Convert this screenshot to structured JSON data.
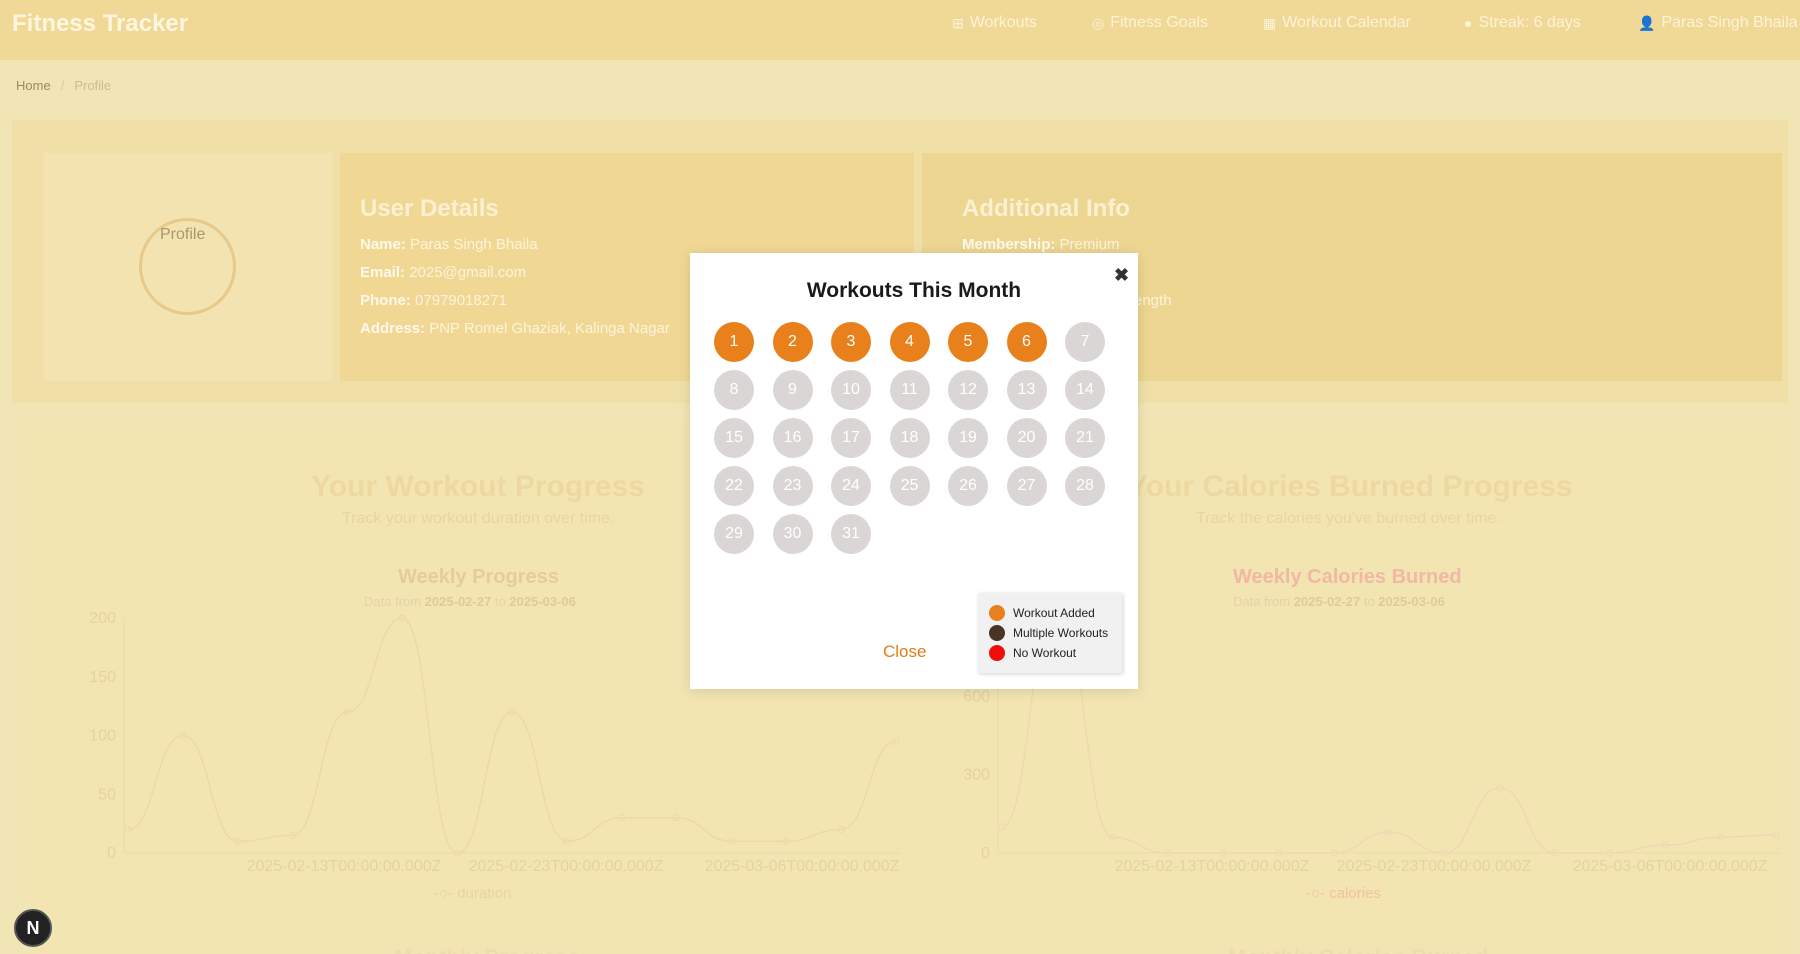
{
  "app": {
    "brand": "Fitness Tracker"
  },
  "nav": {
    "items": [
      {
        "icon": "dumbbell-icon",
        "label": "Workouts"
      },
      {
        "icon": "target-icon",
        "label": "Fitness Goals"
      },
      {
        "icon": "calendar-icon",
        "label": "Workout Calendar"
      },
      {
        "icon": "streak-icon",
        "label": "Streak: 6 days"
      },
      {
        "icon": "user-icon",
        "label": "Paras Singh Bhaila"
      }
    ]
  },
  "breadcrumb": {
    "home": "Home",
    "separator": "/",
    "current": "Profile"
  },
  "profile": {
    "avatar_alt": "Profile"
  },
  "user_details": {
    "title": "User Details",
    "name_label": "Name:",
    "name": "Paras Singh Bhaila",
    "email_label": "Email:",
    "email": "2025@gmail.com",
    "phone_label": "Phone:",
    "phone": "07979018271",
    "address_label": "Address:",
    "address": "PNP Romel Ghaziak, Kalinga Nagar"
  },
  "additional_info": {
    "title": "Additional Info",
    "membership_label": "Membership:",
    "membership": "Premium",
    "partial_text": "ength"
  },
  "workout_progress": {
    "title": "Your Workout Progress",
    "subtitle": "Track your workout duration over time.",
    "chart_title": "Weekly Progress",
    "date_prefix": "Data from",
    "date_from": "2025-02-27",
    "date_to_word": "to",
    "date_to": "2025-03-06",
    "legend": "duration"
  },
  "calories_progress": {
    "title": "Your Calories Burned Progress",
    "subtitle": "Track the calories you've burned over time.",
    "chart_title": "Weekly Calories Burned",
    "date_prefix": "Data from",
    "date_from": "2025-02-27",
    "date_to_word": "to",
    "date_to": "2025-03-06",
    "legend": "calories"
  },
  "bottom": {
    "left_title": "Monthly Progress",
    "right_title": "Monthly Calories Burned"
  },
  "chart_data": [
    {
      "type": "line",
      "title": "Weekly Progress",
      "x_ticks": [
        "2025-02-13T00:00:00.000Z",
        "2025-02-23T00:00:00.000Z",
        "2025-03-06T00:00:00.000Z"
      ],
      "y_ticks": [
        "0",
        "50",
        "100",
        "150",
        "200"
      ],
      "ylim": [
        0,
        200
      ],
      "series": [
        {
          "name": "duration",
          "values": [
            20,
            100,
            10,
            15,
            120,
            200,
            0,
            120,
            10,
            30,
            30,
            10,
            10,
            20,
            95
          ]
        }
      ]
    },
    {
      "type": "line",
      "title": "Weekly Calories Burned",
      "x_ticks": [
        "2025-02-13T00:00:00.000Z",
        "2025-02-23T00:00:00.000Z",
        "2025-03-06T00:00:00.000Z"
      ],
      "y_ticks": [
        "0",
        "300",
        "600"
      ],
      "ylim": [
        0,
        900
      ],
      "series": [
        {
          "name": "calories",
          "values": [
            100,
            950,
            60,
            0,
            0,
            0,
            0,
            80,
            0,
            250,
            0,
            0,
            30,
            60,
            70
          ]
        }
      ]
    }
  ],
  "modal": {
    "title": "Workouts This Month",
    "close_x": "✖",
    "close_label": "Close",
    "days": [
      {
        "n": "1",
        "s": "added"
      },
      {
        "n": "2",
        "s": "added"
      },
      {
        "n": "3",
        "s": "added"
      },
      {
        "n": "4",
        "s": "added"
      },
      {
        "n": "5",
        "s": "added"
      },
      {
        "n": "6",
        "s": "added"
      },
      {
        "n": "7",
        "s": "none"
      },
      {
        "n": "8",
        "s": "none"
      },
      {
        "n": "9",
        "s": "none"
      },
      {
        "n": "10",
        "s": "none"
      },
      {
        "n": "11",
        "s": "none"
      },
      {
        "n": "12",
        "s": "none"
      },
      {
        "n": "13",
        "s": "none"
      },
      {
        "n": "14",
        "s": "none"
      },
      {
        "n": "15",
        "s": "none"
      },
      {
        "n": "16",
        "s": "none"
      },
      {
        "n": "17",
        "s": "none"
      },
      {
        "n": "18",
        "s": "none"
      },
      {
        "n": "19",
        "s": "none"
      },
      {
        "n": "20",
        "s": "none"
      },
      {
        "n": "21",
        "s": "none"
      },
      {
        "n": "22",
        "s": "none"
      },
      {
        "n": "23",
        "s": "none"
      },
      {
        "n": "24",
        "s": "none"
      },
      {
        "n": "25",
        "s": "none"
      },
      {
        "n": "26",
        "s": "none"
      },
      {
        "n": "27",
        "s": "none"
      },
      {
        "n": "28",
        "s": "none"
      },
      {
        "n": "29",
        "s": "none"
      },
      {
        "n": "30",
        "s": "none"
      },
      {
        "n": "31",
        "s": "none"
      }
    ],
    "legend": [
      {
        "label": "Workout Added",
        "color": "#e8801c"
      },
      {
        "label": "Multiple Workouts",
        "color": "#4a3426"
      },
      {
        "label": "No Workout",
        "color": "#f20d0d"
      }
    ]
  },
  "dev": {
    "badge": "N"
  }
}
